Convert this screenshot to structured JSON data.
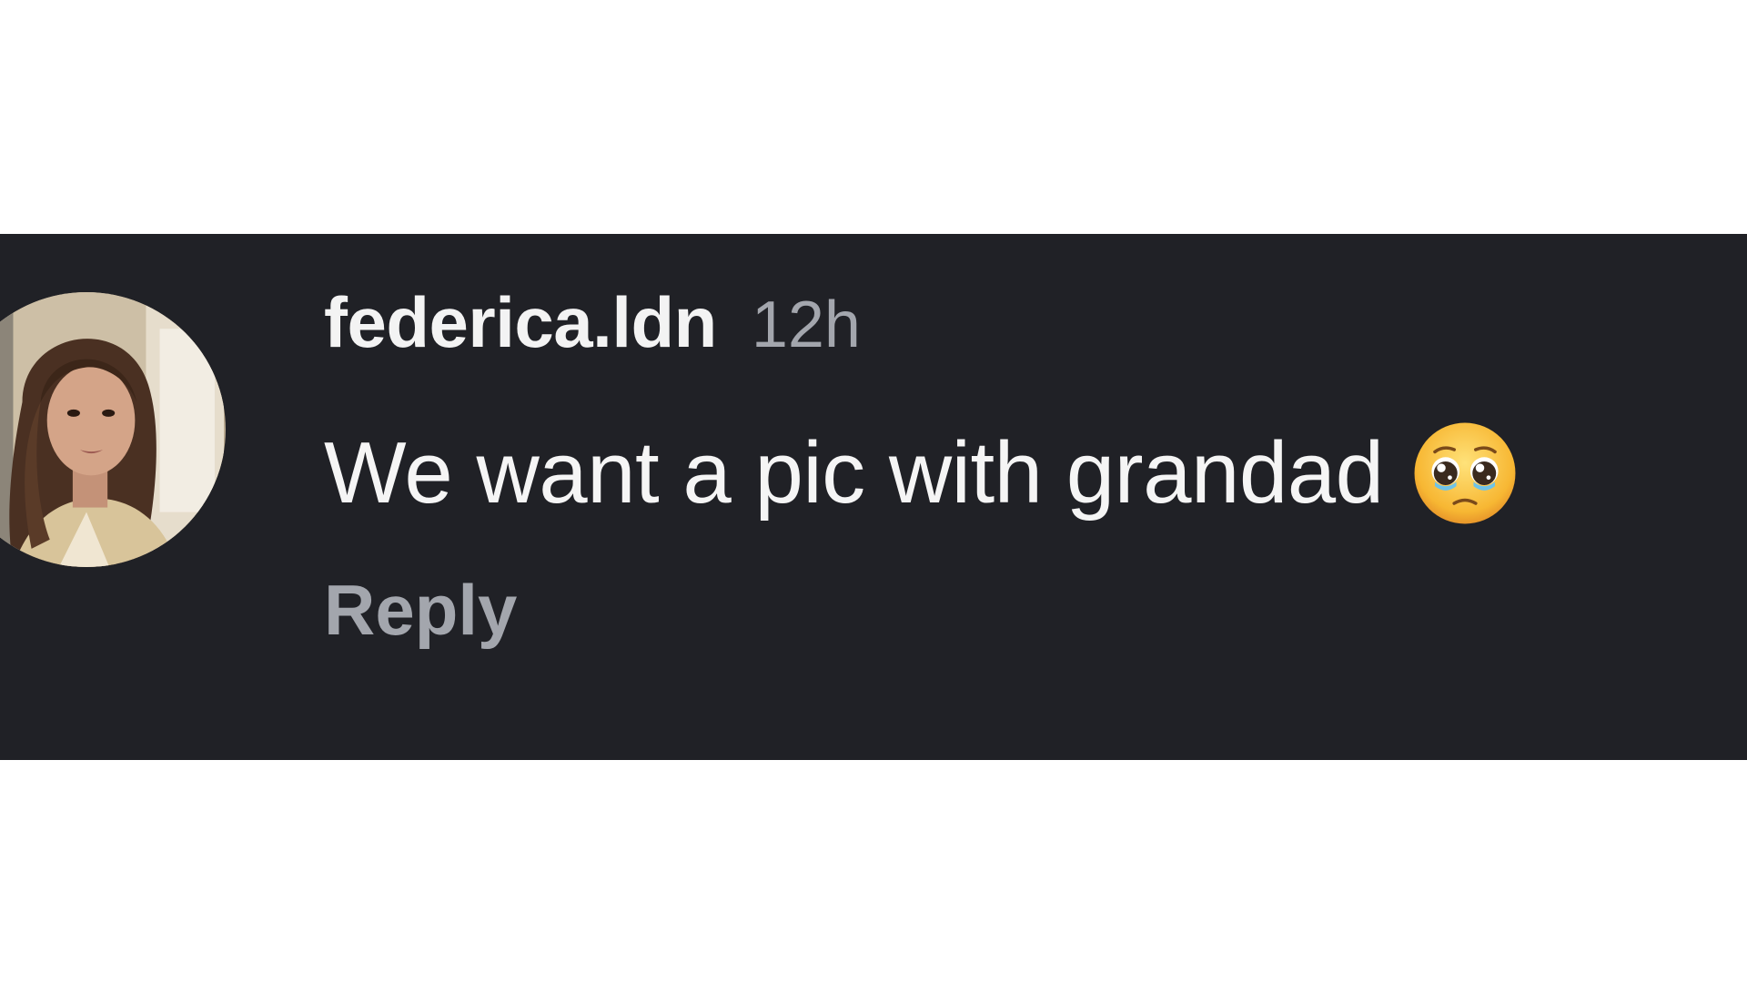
{
  "comment": {
    "username": "federica.ldn",
    "timestamp": "12h",
    "text": "We want a pic with grandad",
    "emoji_icon": "pleading-face-icon",
    "reply_label": "Reply"
  },
  "colors": {
    "panel_background": "#202126",
    "primary_text": "#f3f3f3",
    "secondary_text": "#a3a6ad"
  }
}
